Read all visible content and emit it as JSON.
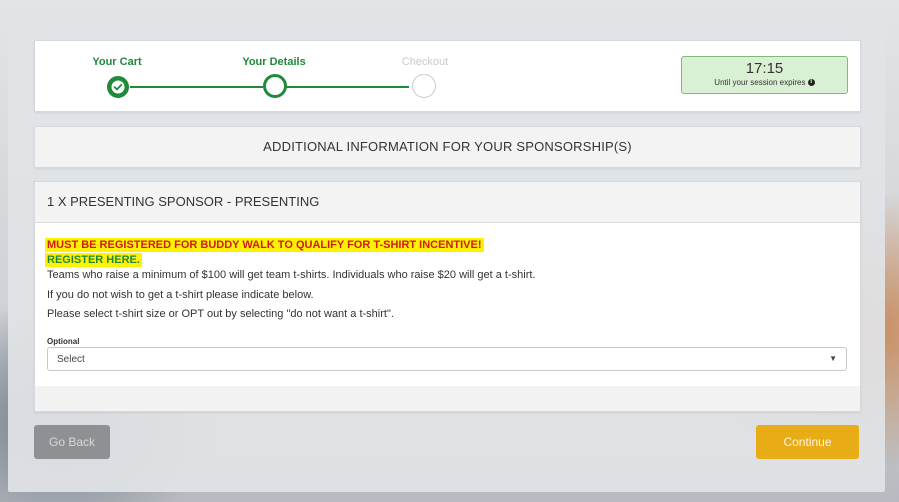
{
  "colors": {
    "accent_green": "#1f8a3a",
    "continue_yellow": "#e8ac17",
    "highlight": "#fff200",
    "warning_red": "#cf1b1b"
  },
  "progress": {
    "steps": [
      {
        "label": "Your Cart",
        "state": "complete"
      },
      {
        "label": "Your Details",
        "state": "current"
      },
      {
        "label": "Checkout",
        "state": "upcoming"
      }
    ]
  },
  "timer": {
    "time": "17:15",
    "caption": "Until your session expires"
  },
  "heading": {
    "title": "ADDITIONAL INFORMATION FOR YOUR SPONSORSHIP(S)"
  },
  "sponsorship": {
    "title": "1 X PRESENTING SPONSOR - PRESENTING",
    "warning": "MUST BE REGISTERED FOR BUDDY WALK TO QUALIFY FOR T-SHIRT INCENTIVE!",
    "register_link": "REGISTER HERE.",
    "lines": [
      "Teams who raise a minimum of $100 will get team t-shirts. Individuals who raise $20 will get a t-shirt.",
      "If you do not wish to get a t-shirt please indicate below.",
      "Please select t-shirt size or OPT out by selecting \"do not want a t-shirt\"."
    ],
    "field_label": "Optional",
    "select_value": "Select"
  },
  "buttons": {
    "back": "Go Back",
    "continue": "Continue"
  },
  "icons": {
    "check": "check-icon",
    "info": "info-icon",
    "caret": "caret-down-icon"
  }
}
